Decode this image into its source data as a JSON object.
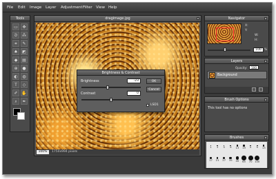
{
  "menu": [
    "File",
    "Edit",
    "Image",
    "Layer",
    "Adjustment",
    "Filter",
    "View",
    "Help"
  ],
  "tools_panel": {
    "title": "Tools",
    "foreground_color": "#000000",
    "background_color": "#ffffff"
  },
  "canvas_window": {
    "title": "dragimage.jpg",
    "zoom": "100%",
    "dimensions": "1750x994 pixels"
  },
  "dialog": {
    "title": "Brightness & Contrast",
    "brightness_label": "Brightness",
    "brightness_value": "-23",
    "brightness_fraction": 0.44,
    "contrast_label": "Contrast",
    "contrast_value": "0",
    "contrast_fraction": 0.5,
    "ok_label": "OK",
    "cancel_label": "Cancel",
    "legacy_label": "LSD1"
  },
  "navigator": {
    "title": "Navigator",
    "x_label": "X:",
    "y_label": "Y:",
    "w_label": "W:",
    "h_label": "H:",
    "zoom_value": "100",
    "zoom_unit": "%"
  },
  "layers": {
    "title": "Layers",
    "opacity_label": "Opacity:",
    "opacity_value": "100",
    "layer_name": "Background"
  },
  "brush_options": {
    "title": "Brush Options",
    "message": "This tool has no options"
  },
  "brushes": {
    "title": "Brushes",
    "sizes": [
      "1",
      "3",
      "5",
      "9",
      "13",
      "19",
      "5",
      "9",
      "13",
      "17",
      "21",
      "27",
      "35",
      "45",
      "65",
      "70",
      "100"
    ]
  }
}
